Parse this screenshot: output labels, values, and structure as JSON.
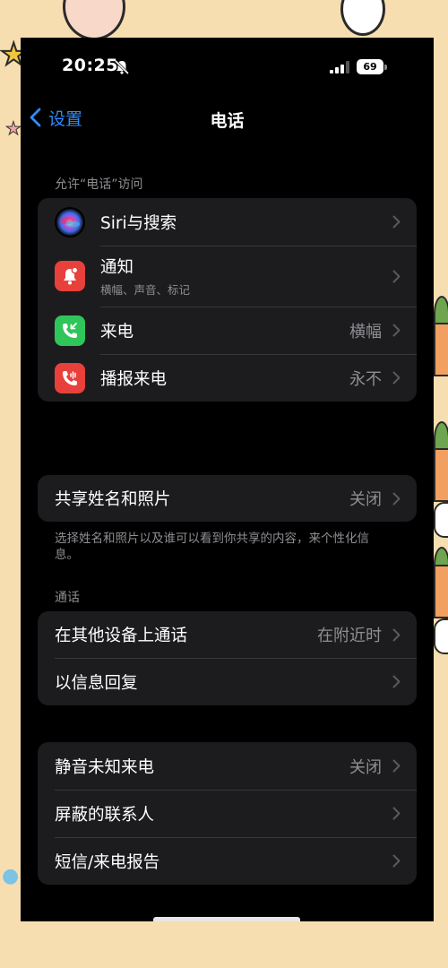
{
  "status_bar": {
    "time": "20:25",
    "battery": "69",
    "mute_icon": "bell-slash-icon",
    "signal_icon": "cellular-signal-icon"
  },
  "nav": {
    "back_label": "设置",
    "title": "电话"
  },
  "section_access": {
    "header": "允许“电话”访问",
    "items": [
      {
        "label": "Siri与搜索",
        "sub": "",
        "value": "",
        "icon": "siri-icon"
      },
      {
        "label": "通知",
        "sub": "横幅、声音、标记",
        "value": "",
        "icon": "notification-bell-icon",
        "color": "#e8403b"
      },
      {
        "label": "来电",
        "sub": "",
        "value": "横幅",
        "icon": "incoming-call-icon",
        "color": "#30c55a"
      },
      {
        "label": "播报来电",
        "sub": "",
        "value": "永不",
        "icon": "announce-calls-icon",
        "color": "#e8403b"
      }
    ]
  },
  "share": {
    "label": "共享姓名和照片",
    "value": "关闭",
    "note": "选择姓名和照片以及谁可以看到你共享的内容，来个性化信息。"
  },
  "section_calls": {
    "header": "通话",
    "items": [
      {
        "label": "在其他设备上通话",
        "value": "在附近时"
      },
      {
        "label": "以信息回复",
        "value": ""
      }
    ]
  },
  "section_more": {
    "items": [
      {
        "label": "静音未知来电",
        "value": "关闭"
      },
      {
        "label": "屏蔽的联系人",
        "value": ""
      },
      {
        "label": "短信/来电报告",
        "value": ""
      }
    ]
  }
}
